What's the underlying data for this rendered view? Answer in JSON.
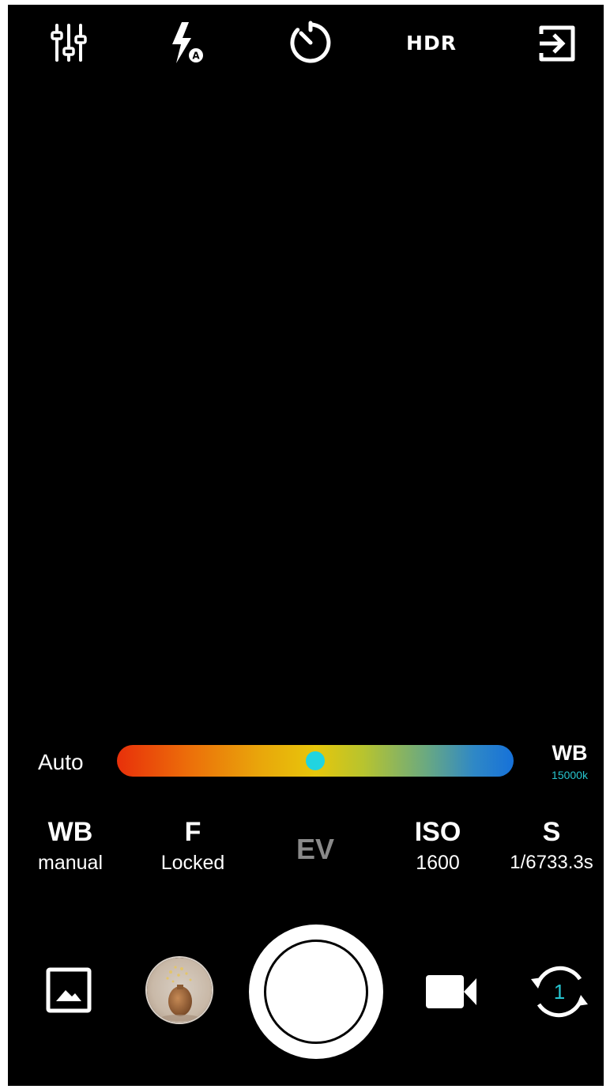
{
  "top_bar": {
    "settings_icon": "sliders-icon",
    "flash_icon": "flash-auto-icon",
    "timer_icon": "timer-icon",
    "hdr_label": "HDR",
    "exit_icon": "exit-icon"
  },
  "white_balance_bar": {
    "auto_label": "Auto",
    "slider_position": 0.5,
    "title": "WB",
    "value": "15000k",
    "thumb_color": "#21d4e0"
  },
  "params": {
    "wb": {
      "name": "WB",
      "value": "manual"
    },
    "f": {
      "name": "F",
      "value": "Locked"
    },
    "ev": {
      "name": "EV"
    },
    "iso": {
      "name": "ISO",
      "value": "1600"
    },
    "s": {
      "name": "S",
      "value": "1/6733.3s"
    }
  },
  "bottom_bar": {
    "gallery_icon": "image-icon",
    "last_photo": "last-photo-thumbnail",
    "shutter": "shutter-button",
    "video_icon": "video-camera-icon",
    "switch_icon": "switch-camera-icon",
    "camera_number": "1"
  },
  "colors": {
    "background": "#000000",
    "accent": "#27c6cf"
  }
}
